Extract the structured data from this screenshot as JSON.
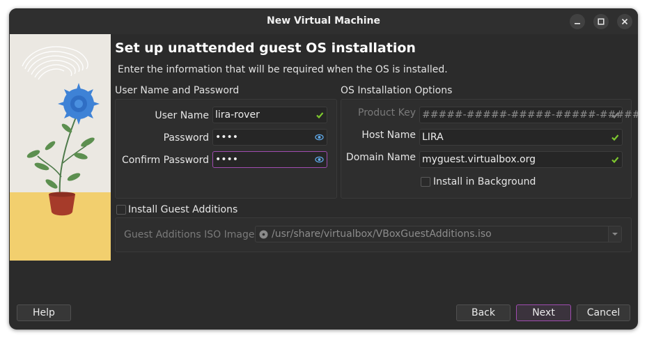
{
  "window": {
    "title": "New Virtual Machine"
  },
  "page": {
    "heading": "Set up unattended guest OS installation",
    "subtitle": "Enter the information that will be required when the OS is installed."
  },
  "user_group": {
    "title": "User Name and Password",
    "username_label": "User Name",
    "username_value": "lira-rover",
    "password_label": "Password",
    "password_value": "••••",
    "confirm_label": "Confirm Password",
    "confirm_value": "••••"
  },
  "os_group": {
    "title": "OS Installation Options",
    "product_key_label": "Product Key",
    "product_key_value": "#####-#####-#####-#####-#####",
    "host_name_label": "Host Name",
    "host_name_value": "LIRA",
    "domain_name_label": "Domain Name",
    "domain_name_value": "myguest.virtualbox.org",
    "install_background_label": "Install in Background"
  },
  "guest_additions": {
    "checkbox_label": "Install Guest Additions",
    "iso_label": "Guest Additions ISO Image:",
    "iso_path": "/usr/share/virtualbox/VBoxGuestAdditions.iso"
  },
  "buttons": {
    "help": "Help",
    "back": "Back",
    "next": "Next",
    "cancel": "Cancel"
  },
  "colors": {
    "window_bg": "#2b2b2b",
    "accent": "#a04cb0",
    "valid_check": "#7ec82f",
    "eye_icon": "#5fa8e8"
  }
}
